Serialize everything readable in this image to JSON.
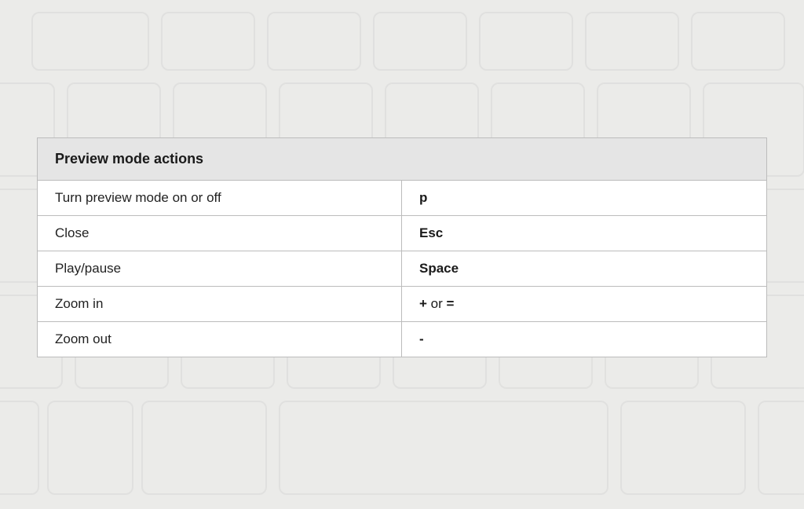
{
  "table": {
    "title": "Preview mode actions",
    "rows": [
      {
        "action": "Turn preview mode on or off",
        "keys": [
          {
            "text": "p",
            "bold": true
          }
        ]
      },
      {
        "action": "Close",
        "keys": [
          {
            "text": "Esc",
            "bold": true
          }
        ]
      },
      {
        "action": "Play/pause",
        "keys": [
          {
            "text": "Space",
            "bold": true
          }
        ]
      },
      {
        "action": "Zoom in",
        "keys": [
          {
            "text": "+",
            "bold": true
          },
          {
            "text": " or ",
            "bold": false
          },
          {
            "text": "=",
            "bold": true
          }
        ]
      },
      {
        "action": "Zoom out",
        "keys": [
          {
            "text": "-",
            "bold": true
          }
        ]
      }
    ]
  }
}
